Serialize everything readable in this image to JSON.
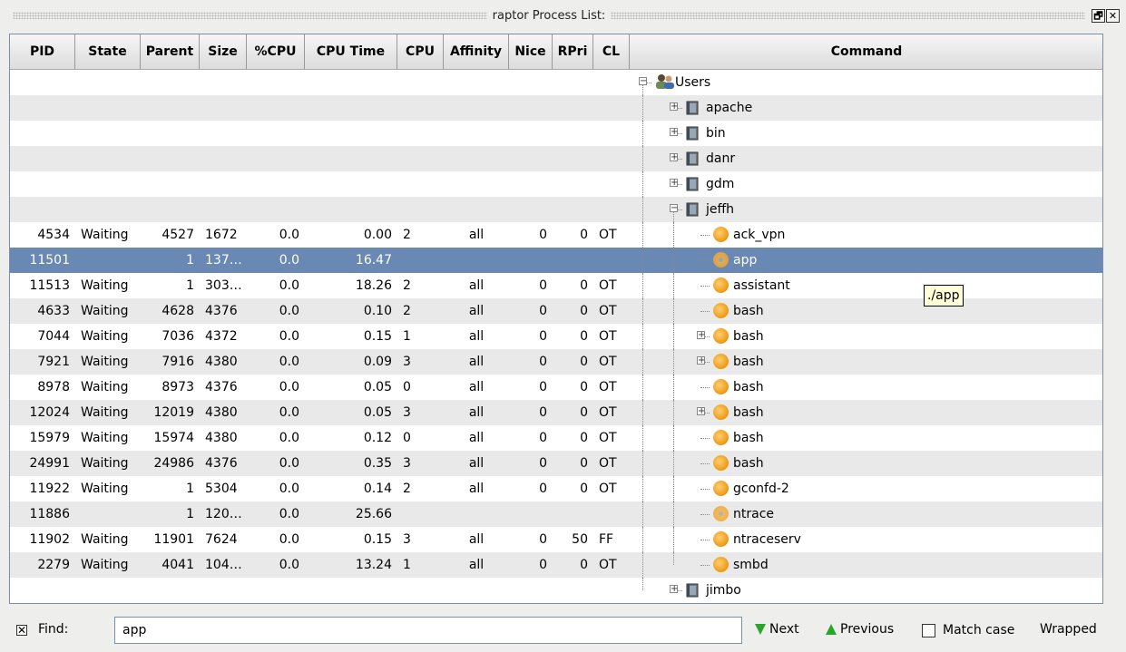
{
  "window": {
    "title": "raptor Process List:",
    "btn_restore": "🗗",
    "btn_close": "✕"
  },
  "columns": [
    {
      "label": "PID",
      "w": 72,
      "align": "r"
    },
    {
      "label": "State",
      "w": 72,
      "align": "l"
    },
    {
      "label": "Parent",
      "w": 65,
      "align": "r"
    },
    {
      "label": "Size",
      "w": 52,
      "align": "l"
    },
    {
      "label": "%CPU",
      "w": 64,
      "align": "r"
    },
    {
      "label": "CPU Time",
      "w": 102,
      "align": "r"
    },
    {
      "label": "CPU",
      "w": 51,
      "align": "l"
    },
    {
      "label": "Affinity",
      "w": 72,
      "align": "ctr"
    },
    {
      "label": "Nice",
      "w": 48,
      "align": "r"
    },
    {
      "label": "RPri",
      "w": 45,
      "align": "r"
    },
    {
      "label": "CL",
      "w": 40,
      "align": "l"
    },
    {
      "label": "Command",
      "w": 0,
      "align": "l"
    }
  ],
  "rows": [
    {
      "cells": [
        "",
        "",
        "",
        "",
        "",
        "",
        "",
        "",
        "",
        "",
        ""
      ],
      "cmd": "Users",
      "level": 0,
      "icon": "users",
      "expander": "minus"
    },
    {
      "cells": [
        "",
        "",
        "",
        "",
        "",
        "",
        "",
        "",
        "",
        "",
        ""
      ],
      "cmd": "apache",
      "level": 1,
      "icon": "user",
      "expander": "plus"
    },
    {
      "cells": [
        "",
        "",
        "",
        "",
        "",
        "",
        "",
        "",
        "",
        "",
        ""
      ],
      "cmd": "bin",
      "level": 1,
      "icon": "user",
      "expander": "plus"
    },
    {
      "cells": [
        "",
        "",
        "",
        "",
        "",
        "",
        "",
        "",
        "",
        "",
        ""
      ],
      "cmd": "danr",
      "level": 1,
      "icon": "user",
      "expander": "plus"
    },
    {
      "cells": [
        "",
        "",
        "",
        "",
        "",
        "",
        "",
        "",
        "",
        "",
        ""
      ],
      "cmd": "gdm",
      "level": 1,
      "icon": "user",
      "expander": "plus"
    },
    {
      "cells": [
        "",
        "",
        "",
        "",
        "",
        "",
        "",
        "",
        "",
        "",
        ""
      ],
      "cmd": "jeffh",
      "level": 1,
      "icon": "user",
      "expander": "minus"
    },
    {
      "cells": [
        "4534",
        "Waiting",
        "4527",
        "1672",
        "0.0",
        "0.00",
        "2",
        "all",
        "0",
        "0",
        "OT"
      ],
      "cmd": "ack_vpn",
      "level": 2,
      "icon": "proc",
      "expander": ""
    },
    {
      "cells": [
        "11501",
        "",
        "1",
        "137…",
        "0.0",
        "16.47",
        "",
        "",
        "",
        "",
        ""
      ],
      "cmd": "app",
      "level": 2,
      "icon": "gear",
      "expander": "",
      "selected": true
    },
    {
      "cells": [
        "11513",
        "Waiting",
        "1",
        "303…",
        "0.0",
        "18.26",
        "2",
        "all",
        "0",
        "0",
        "OT"
      ],
      "cmd": "assistant",
      "level": 2,
      "icon": "proc",
      "expander": ""
    },
    {
      "cells": [
        "4633",
        "Waiting",
        "4628",
        "4376",
        "0.0",
        "0.10",
        "2",
        "all",
        "0",
        "0",
        "OT"
      ],
      "cmd": "bash",
      "level": 2,
      "icon": "proc",
      "expander": ""
    },
    {
      "cells": [
        "7044",
        "Waiting",
        "7036",
        "4372",
        "0.0",
        "0.15",
        "1",
        "all",
        "0",
        "0",
        "OT"
      ],
      "cmd": "bash",
      "level": 2,
      "icon": "proc",
      "expander": "plus"
    },
    {
      "cells": [
        "7921",
        "Waiting",
        "7916",
        "4380",
        "0.0",
        "0.09",
        "3",
        "all",
        "0",
        "0",
        "OT"
      ],
      "cmd": "bash",
      "level": 2,
      "icon": "proc",
      "expander": "plus"
    },
    {
      "cells": [
        "8978",
        "Waiting",
        "8973",
        "4376",
        "0.0",
        "0.05",
        "0",
        "all",
        "0",
        "0",
        "OT"
      ],
      "cmd": "bash",
      "level": 2,
      "icon": "proc",
      "expander": ""
    },
    {
      "cells": [
        "12024",
        "Waiting",
        "12019",
        "4380",
        "0.0",
        "0.05",
        "3",
        "all",
        "0",
        "0",
        "OT"
      ],
      "cmd": "bash",
      "level": 2,
      "icon": "proc",
      "expander": "plus"
    },
    {
      "cells": [
        "15979",
        "Waiting",
        "15974",
        "4380",
        "0.0",
        "0.12",
        "0",
        "all",
        "0",
        "0",
        "OT"
      ],
      "cmd": "bash",
      "level": 2,
      "icon": "proc",
      "expander": ""
    },
    {
      "cells": [
        "24991",
        "Waiting",
        "24986",
        "4376",
        "0.0",
        "0.35",
        "3",
        "all",
        "0",
        "0",
        "OT"
      ],
      "cmd": "bash",
      "level": 2,
      "icon": "proc",
      "expander": ""
    },
    {
      "cells": [
        "11922",
        "Waiting",
        "1",
        "5304",
        "0.0",
        "0.14",
        "2",
        "all",
        "0",
        "0",
        "OT"
      ],
      "cmd": "gconfd-2",
      "level": 2,
      "icon": "proc",
      "expander": ""
    },
    {
      "cells": [
        "11886",
        "",
        "1",
        "120…",
        "0.0",
        "25.66",
        "",
        "",
        "",
        "",
        ""
      ],
      "cmd": "ntrace",
      "level": 2,
      "icon": "gear",
      "expander": ""
    },
    {
      "cells": [
        "11902",
        "Waiting",
        "11901",
        "7624",
        "0.0",
        "0.15",
        "3",
        "all",
        "0",
        "50",
        "FF"
      ],
      "cmd": "ntraceserv",
      "level": 2,
      "icon": "proc",
      "expander": ""
    },
    {
      "cells": [
        "2279",
        "Waiting",
        "4041",
        "104…",
        "0.0",
        "13.24",
        "1",
        "all",
        "0",
        "0",
        "OT"
      ],
      "cmd": "smbd",
      "level": 2,
      "icon": "proc",
      "expander": ""
    },
    {
      "cells": [
        "",
        "",
        "",
        "",
        "",
        "",
        "",
        "",
        "",
        "",
        ""
      ],
      "cmd": "jimbo",
      "level": 1,
      "icon": "user",
      "expander": "plus"
    }
  ],
  "tooltip": "./app",
  "find": {
    "checkbox_mark": "✕",
    "label": "Find:",
    "value": "app",
    "next": "Next",
    "previous": "Previous",
    "match_case": "Match case",
    "status": "Wrapped"
  },
  "scroll": {
    "up": "▲",
    "down": "▼"
  },
  "colors": {
    "selection": "#6a88b4",
    "alt_row": "#e9e9e9",
    "arrow": "#29a629"
  }
}
